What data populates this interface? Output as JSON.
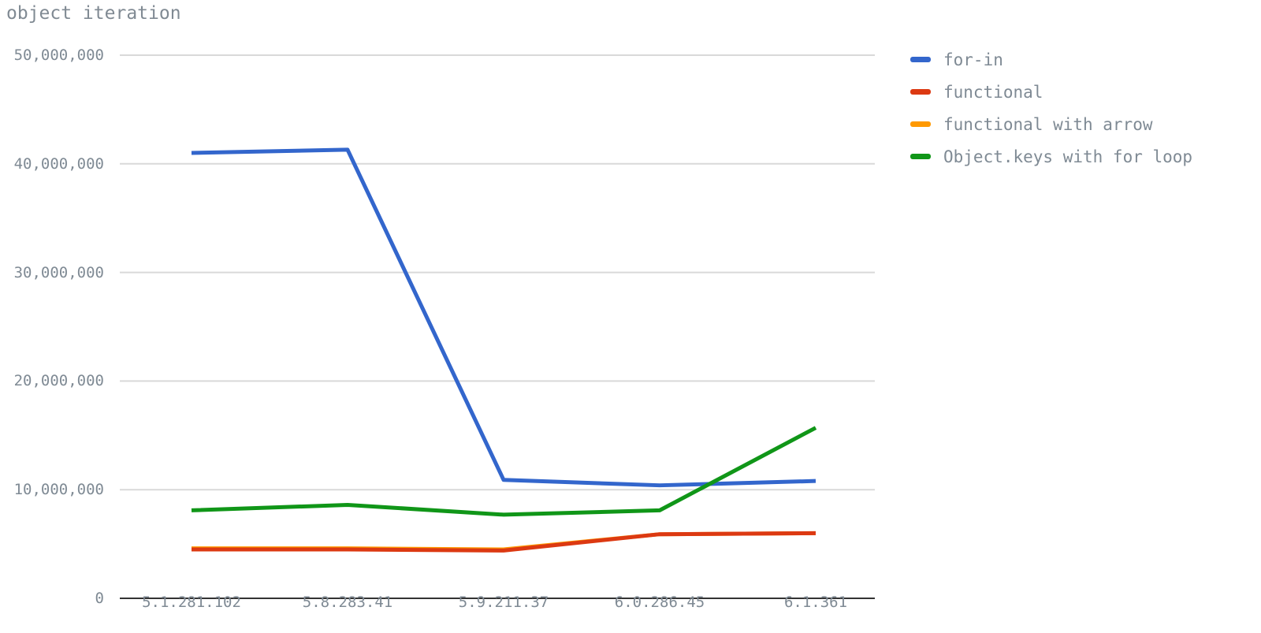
{
  "chart_data": {
    "type": "line",
    "title": "object iteration",
    "xlabel": "",
    "ylabel": "",
    "categories": [
      "5.1.281.102",
      "5.8.283.41",
      "5.9.211.37",
      "6.0.286.45",
      "6.1.361"
    ],
    "ylim": [
      0,
      50000000
    ],
    "yticks": [
      0,
      10000000,
      20000000,
      30000000,
      40000000,
      50000000
    ],
    "ytick_labels": [
      "0",
      "10,000,000",
      "20,000,000",
      "30,000,000",
      "40,000,000",
      "50,000,000"
    ],
    "grid": true,
    "legend_position": "right",
    "series": [
      {
        "name": "for-in",
        "color": "#3366cc",
        "values": [
          41000000,
          41300000,
          10900000,
          10400000,
          10800000
        ]
      },
      {
        "name": "functional",
        "color": "#dc3912",
        "values": [
          4500000,
          4500000,
          4400000,
          5900000,
          6000000
        ]
      },
      {
        "name": "functional with arrow",
        "color": "#ff9900",
        "values": [
          4600000,
          4600000,
          4500000,
          5900000,
          6000000
        ]
      },
      {
        "name": "Object.keys with for loop",
        "color": "#109618",
        "values": [
          8100000,
          8600000,
          7700000,
          8100000,
          15700000
        ]
      }
    ]
  },
  "colors": {
    "axis_line": "#333333",
    "grid_line": "#d9d9d9",
    "label_text": "#7f8a94",
    "title_text": "#808a93",
    "background": "#ffffff"
  }
}
